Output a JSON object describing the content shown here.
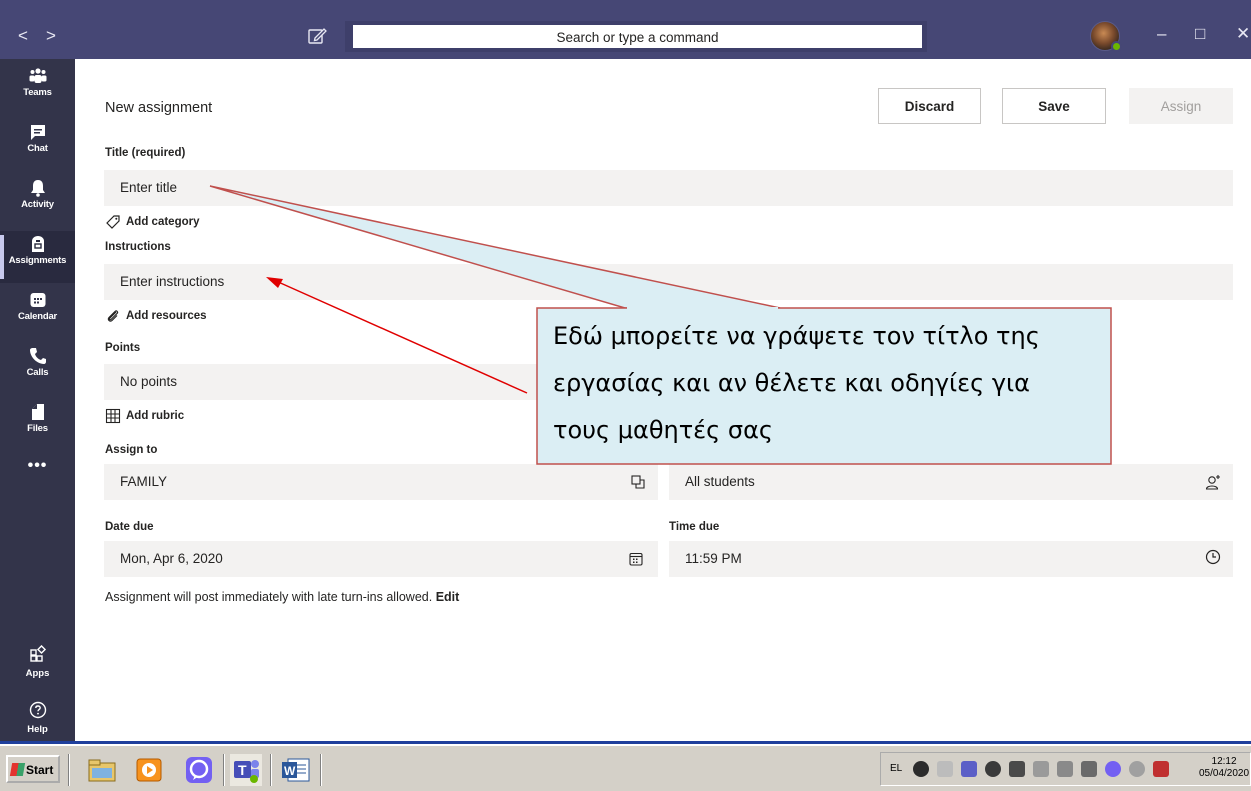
{
  "titlebar": {
    "search_placeholder": "Search or type a command",
    "back_glyph": "<",
    "forward_glyph": ">",
    "minimize_glyph": "–",
    "maximize_glyph": "□",
    "close_glyph": "✕",
    "bg_color": "#464775"
  },
  "rail": {
    "items": [
      {
        "label": "Teams",
        "icon": "teams-icon"
      },
      {
        "label": "Chat",
        "icon": "chat-icon"
      },
      {
        "label": "Activity",
        "icon": "bell-icon"
      },
      {
        "label": "Assignments",
        "icon": "assignments-icon",
        "active": true
      },
      {
        "label": "Calendar",
        "icon": "calendar-icon"
      },
      {
        "label": "Calls",
        "icon": "phone-icon"
      },
      {
        "label": "Files",
        "icon": "file-icon"
      }
    ],
    "more": "•••",
    "apps_label": "Apps",
    "help_label": "Help"
  },
  "form": {
    "page_title": "New assignment",
    "discard_label": "Discard",
    "save_label": "Save",
    "assign_label": "Assign",
    "title_label": "Title (required)",
    "title_placeholder": "Enter title",
    "add_category": "Add category",
    "instructions_label": "Instructions",
    "instructions_placeholder": "Enter instructions",
    "add_resources": "Add resources",
    "points_label": "Points",
    "points_value": "No points",
    "add_rubric": "Add rubric",
    "assign_to_label": "Assign to",
    "class_value": "FAMILY",
    "students_value": "All students",
    "date_due_label": "Date due",
    "date_due_value": "Mon, Apr 6, 2020",
    "time_due_label": "Time due",
    "time_due_value": "11:59 PM",
    "note_text": "Assignment will post immediately with late turn-ins allowed. ",
    "note_edit": "Edit"
  },
  "callout": {
    "line1": "Εδώ μπορείτε να γράψετε τον τίτλο της",
    "line2": "εργασίας και αν θέλετε και οδηγίες για",
    "line3": "τους μαθητές σας",
    "fill_color": "#dbeef4",
    "border_color": "#c0504d"
  },
  "taskbar": {
    "start_label": "Start",
    "lang": "EL",
    "time": "12:12",
    "date": "05/04/2020"
  }
}
